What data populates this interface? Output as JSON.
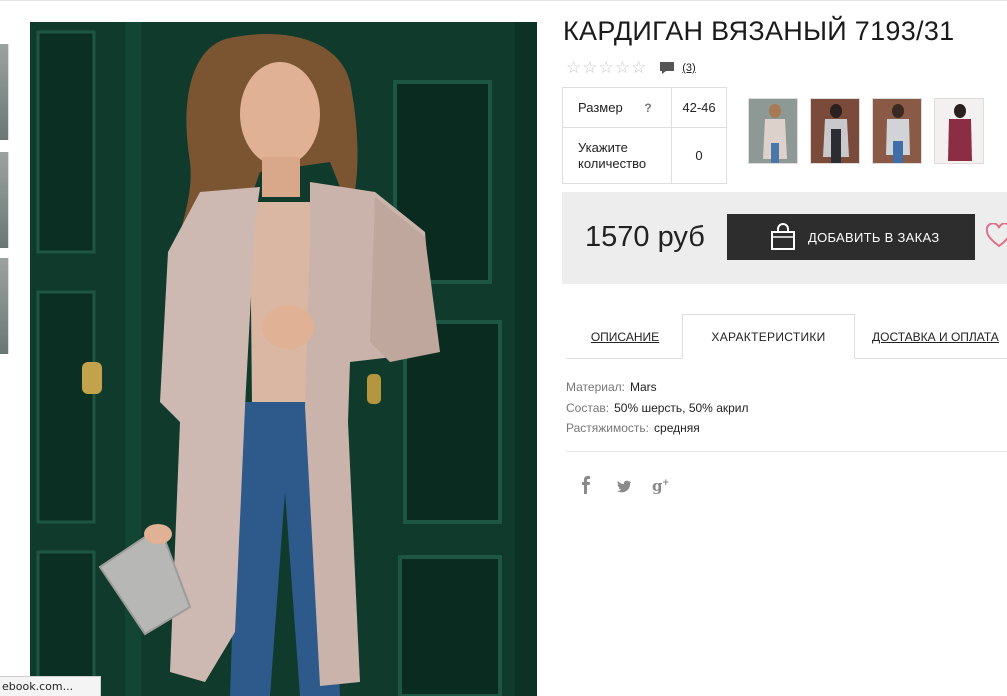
{
  "product": {
    "title": "КАРДИГАН ВЯЗАНЫЙ 7193/31",
    "rating": {
      "stars_filled": 0,
      "stars_total": 5,
      "reviews_count": "(3)"
    },
    "params": {
      "size_label": "Размер",
      "size_help": "?",
      "size_value": "42-46",
      "qty_label_line1": "Укажите",
      "qty_label_line2": "количество",
      "qty_value": "0"
    },
    "price": "1570 руб",
    "add_to_order_label": "ДОБАВИТЬ В ЗАКАЗ"
  },
  "tabs": [
    {
      "label": "ОПИСАНИЕ",
      "active": false
    },
    {
      "label": "ХАРАКТЕРИСТИКИ",
      "active": true
    },
    {
      "label": "ДОСТАВКА И ОПЛАТА",
      "active": false
    }
  ],
  "specs": [
    {
      "key": "Материал:",
      "value": "Mars"
    },
    {
      "key": "Состав:",
      "value": "50% шерсть, 50% акрил"
    },
    {
      "key": "Растяжимость:",
      "value": "средняя"
    }
  ],
  "social": [
    "facebook-icon",
    "twitter-icon",
    "google-plus-icon"
  ],
  "status_bar": {
    "url_text": "ebook.com..."
  },
  "colors": {
    "accent_dark": "#2d2d2d",
    "buy_box_bg": "#ededed",
    "heart_pink": "#e26f8a",
    "door_green": "#0f3a2c",
    "cardigan_beige": "#cdb9b1"
  },
  "icons": {
    "star": "star-outline-icon",
    "comment": "speech-bubble-icon",
    "bag": "shopping-bag-icon",
    "heart": "heart-outline-icon"
  }
}
